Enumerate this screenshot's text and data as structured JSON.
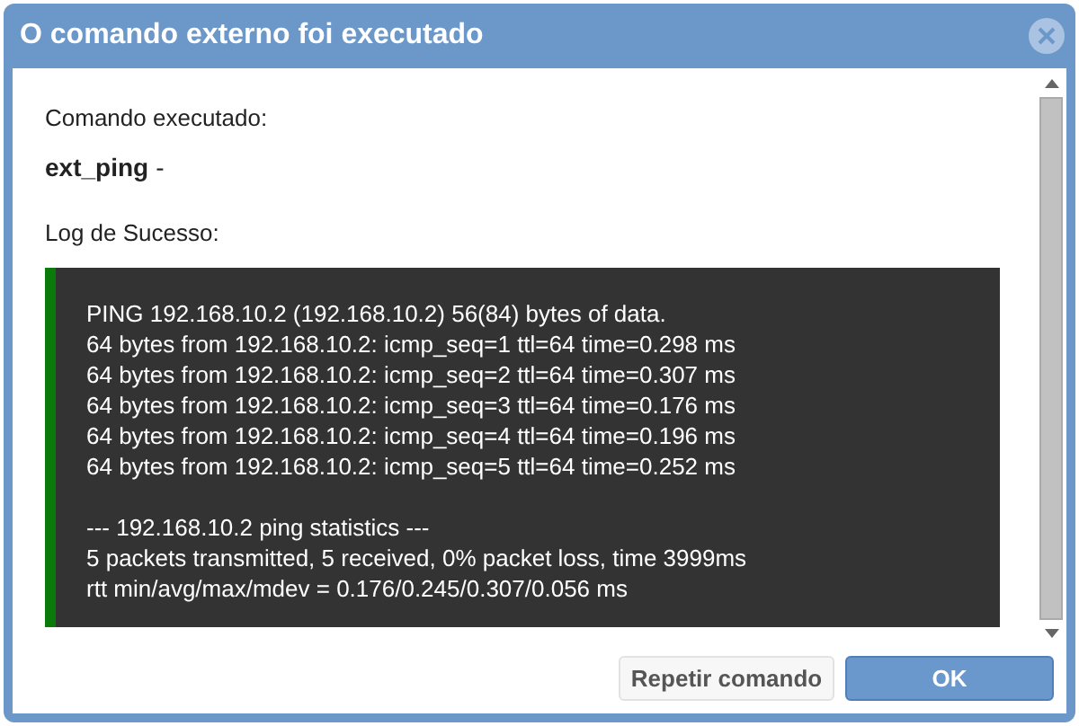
{
  "window": {
    "title": "O comando externo foi executado"
  },
  "command": {
    "label": "Comando executado:",
    "value": "ext_ping",
    "suffix": "-"
  },
  "log": {
    "label": "Log de Sucesso:",
    "output": [
      "PING 192.168.10.2 (192.168.10.2) 56(84) bytes of data.",
      "64 bytes from 192.168.10.2: icmp_seq=1 ttl=64 time=0.298 ms",
      "64 bytes from 192.168.10.2: icmp_seq=2 ttl=64 time=0.307 ms",
      "64 bytes from 192.168.10.2: icmp_seq=3 ttl=64 time=0.176 ms",
      "64 bytes from 192.168.10.2: icmp_seq=4 ttl=64 time=0.196 ms",
      "64 bytes from 192.168.10.2: icmp_seq=5 ttl=64 time=0.252 ms"
    ],
    "statistics": [
      "--- 192.168.10.2 ping statistics ---",
      "5 packets transmitted, 5 received, 0% packet loss, time 3999ms",
      "rtt min/avg/max/mdev = 0.176/0.245/0.307/0.056 ms"
    ]
  },
  "buttons": [
    {
      "label": "Repetir comando",
      "kind": "secondary"
    },
    {
      "label": "OK",
      "kind": "primary"
    }
  ]
}
